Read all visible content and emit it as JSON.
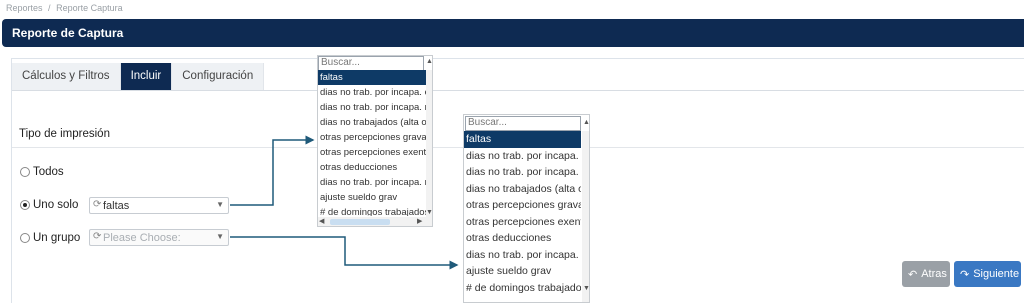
{
  "breadcrumb": [
    "Reportes",
    "/",
    "Reporte Captura"
  ],
  "header": {
    "title": "Reporte de Captura"
  },
  "tabs": [
    {
      "label": "Cálculos y Filtros",
      "active": false
    },
    {
      "label": "Incluir",
      "active": true
    },
    {
      "label": "Configuración",
      "active": false
    }
  ],
  "section": {
    "title": "Tipo de impresión"
  },
  "options": {
    "todos": {
      "label": "Todos",
      "checked": false
    },
    "uno_solo": {
      "label": "Uno solo",
      "checked": true,
      "select_value": "faltas"
    },
    "un_grupo": {
      "label": "Un grupo",
      "checked": false,
      "select_placeholder": "Please Choose:"
    }
  },
  "dropdown_small": {
    "search_placeholder": "Buscar...",
    "items": [
      "faltas",
      "dias no trab. por incapa. enfermedad",
      "dias no trab. por incapa. riesgo",
      "dias no trabajados (alta o baja)",
      "otras percepciones gravables",
      "otras percepciones exentas",
      "otras deducciones",
      "dias no trab. por incapa. maternidad",
      "ajuste sueldo grav",
      "# de domingos trabajados"
    ],
    "selected": "faltas"
  },
  "dropdown_large": {
    "search_placeholder": "Buscar...",
    "items": [
      "faltas",
      "dias no trab. por incapa. enfermedad",
      "dias no trab. por incapa. riesgo",
      "dias no trabajados (alta o baja)",
      "otras percepciones gravables",
      "otras percepciones exentas",
      "otras deducciones",
      "dias no trab. por incapa. maternidad",
      "ajuste sueldo grav",
      "# de domingos trabajados"
    ],
    "selected": "faltas"
  },
  "buttons": {
    "back": "Atras",
    "next": "Siguiente"
  },
  "colors": {
    "navy": "#0e2a52",
    "accent": "#3a78c3",
    "connector": "#1f5a7a"
  }
}
